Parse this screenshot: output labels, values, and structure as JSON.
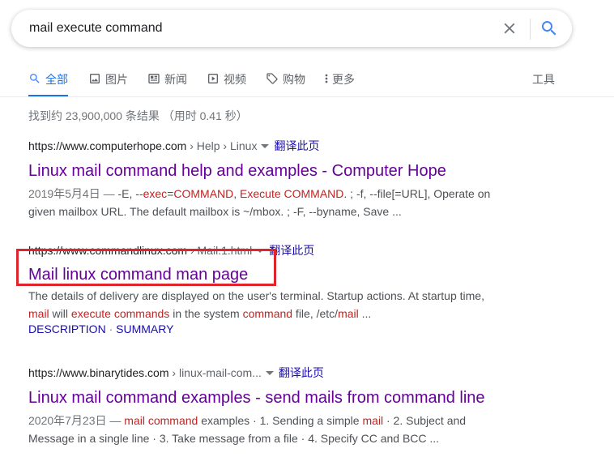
{
  "search": {
    "query": "mail execute command",
    "clear_icon": "close-icon",
    "search_icon": "search-icon"
  },
  "tabs": [
    {
      "label": "全部",
      "icon": "search-icon",
      "active": true
    },
    {
      "label": "图片",
      "icon": "image-icon",
      "active": false
    },
    {
      "label": "新闻",
      "icon": "news-icon",
      "active": false
    },
    {
      "label": "视频",
      "icon": "video-icon",
      "active": false
    },
    {
      "label": "购物",
      "icon": "tag-icon",
      "active": false
    },
    {
      "label": "更多",
      "icon": "more-icon",
      "active": false
    }
  ],
  "tools_label": "工具",
  "stats": "找到约 23,900,000 条结果 （用时 0.41 秒）",
  "results": [
    {
      "domain": "https://www.computerhope.com",
      "path": " › Help › Linux",
      "translate": "翻译此页",
      "title": "Linux mail command help and examples - Computer Hope",
      "snippet": {
        "date": "2019年5月4日 — ",
        "p1": "-E, --",
        "h1": "exec",
        "p2": "=",
        "h2": "COMMAND",
        "p3": ", ",
        "h3": "Execute COMMAND",
        "p4": ". ; -f, --file[=URL], Operate on given mailbox URL. The default mailbox is ~/mbox. ; -F, --byname, Save ..."
      }
    },
    {
      "domain": "https://www.commandlinux.com",
      "path": " › Mail.1.html",
      "translate": "翻译此页",
      "title": "Mail linux command man page",
      "snippet": {
        "p1": "The details of delivery are displayed on the user's terminal. Startup actions. At startup time, ",
        "h1": "mail",
        "p2": " will ",
        "h2": "execute commands",
        "p3": " in the system ",
        "h3": "command",
        "p4": " file, /etc/",
        "h4": "mail",
        "p5": " ..."
      },
      "sublinks": [
        "DESCRIPTION",
        "SUMMARY"
      ],
      "sublink_sep": " · "
    },
    {
      "domain": "https://www.binarytides.com",
      "path": " › linux-mail-com...",
      "translate": "翻译此页",
      "title": "Linux mail command examples - send mails from command line",
      "snippet": {
        "date": "2020年7月23日 — ",
        "h1": "mail command",
        "p1": " examples · 1. Sending a simple ",
        "h2": "mail",
        "p2": " · 2. Subject and Message in a single line · 3. Take message from a file · 4. Specify CC and BCC ..."
      }
    }
  ],
  "colors": {
    "accent": "#1a73e8",
    "visited_title": "#660099",
    "link": "#1a0dab",
    "highlight_term": "#c5221f",
    "annotation_box": "#e0242b"
  }
}
